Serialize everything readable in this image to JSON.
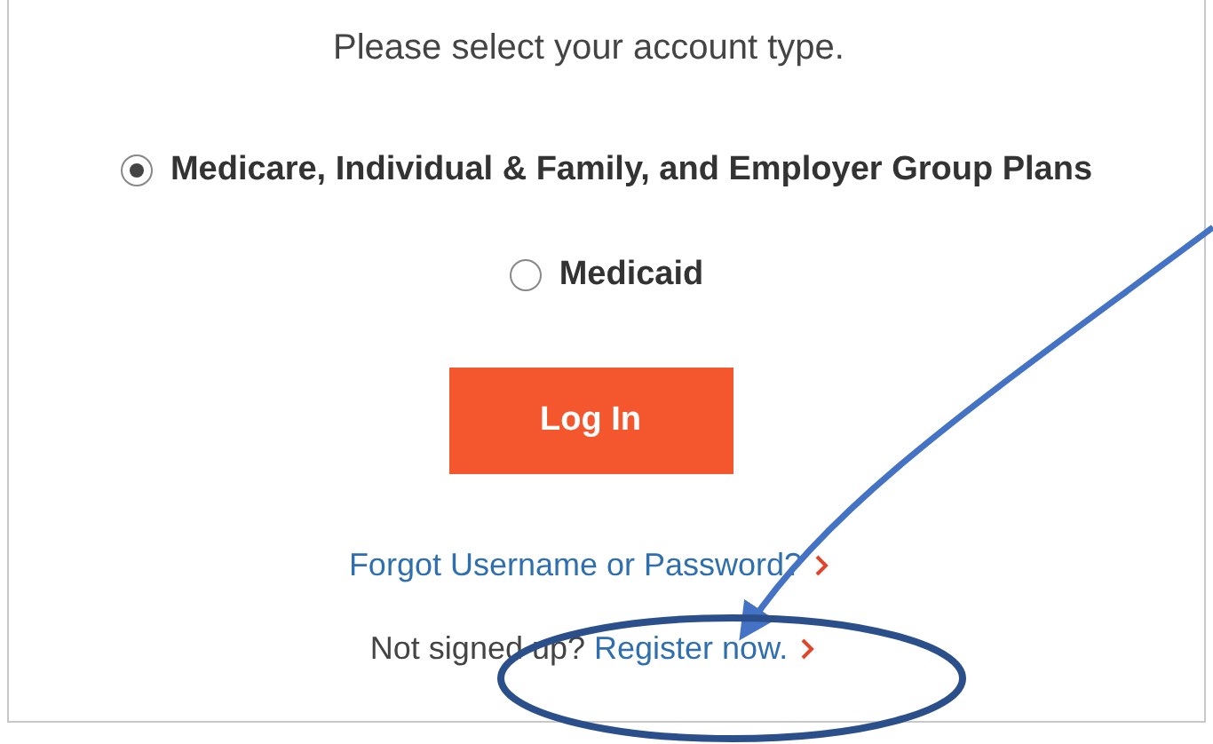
{
  "title": "Please select your account type.",
  "account_types": [
    {
      "label": "Medicare, Individual & Family, and Employer Group Plans",
      "selected": true
    },
    {
      "label": "Medicaid",
      "selected": false
    }
  ],
  "login_button": "Log In",
  "forgot_link": "Forgot Username or Password?",
  "signup": {
    "prompt": "Not signed up?",
    "link": "Register now."
  }
}
